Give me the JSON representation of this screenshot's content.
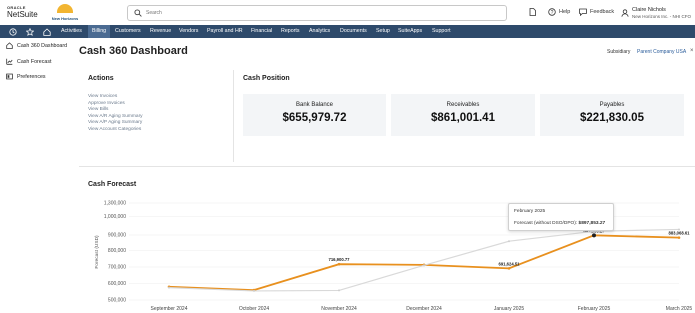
{
  "header": {
    "brand_small": "ORACLE",
    "brand": "NetSuite",
    "company_logo_text": "New Horizons",
    "search_placeholder": "Search",
    "help_label": "Help",
    "feedback_label": "Feedback",
    "user_name": "Claire Nichols",
    "user_role": "New Horizons Inc. - NHI CFO"
  },
  "nav": {
    "items": [
      {
        "label": "Activities"
      },
      {
        "label": "Billing"
      },
      {
        "label": "Customers"
      },
      {
        "label": "Revenue"
      },
      {
        "label": "Vendors"
      },
      {
        "label": "Payroll and HR"
      },
      {
        "label": "Financial"
      },
      {
        "label": "Reports"
      },
      {
        "label": "Analytics"
      },
      {
        "label": "Documents"
      },
      {
        "label": "Setup"
      },
      {
        "label": "SuiteApps"
      },
      {
        "label": "Support"
      }
    ],
    "active": "Billing"
  },
  "sidebar": {
    "items": [
      {
        "label": "Cash 360 Dashboard",
        "icon": "home-icon"
      },
      {
        "label": "Cash Forecast",
        "icon": "chart-icon"
      },
      {
        "label": "Preferences",
        "icon": "settings-icon"
      }
    ]
  },
  "page": {
    "title": "Cash 360 Dashboard",
    "subsidiary_label": "Subsidiary",
    "subsidiary_value": "Parent Company USA",
    "close_symbol": "×"
  },
  "actions": {
    "heading": "Actions",
    "links": [
      "View Invoices",
      "Approve Invoices",
      "View Bills",
      "View A/R Aging Summary",
      "View A/P Aging Summary",
      "View Account Categories"
    ]
  },
  "cash_position": {
    "heading": "Cash Position",
    "cards": [
      {
        "label": "Bank Balance",
        "value": "$655,979.72"
      },
      {
        "label": "Receivables",
        "value": "$861,001.41"
      },
      {
        "label": "Payables",
        "value": "$221,830.05"
      }
    ]
  },
  "forecast": {
    "heading": "Cash Forecast",
    "tooltip": {
      "month": "February 2025",
      "series_label": "Forecast (without DSO/DPO):",
      "value": "$897,853.27"
    }
  },
  "colors": {
    "nav_bg": "#2e4a6b",
    "nav_active": "#4b6b92",
    "forecast_line": "#e8901e",
    "secondary_line": "#d9d9d9"
  },
  "chart_data": {
    "type": "line",
    "ylabel": "Forecast (USD)",
    "ylim": [
      500000,
      1300000
    ],
    "y_ticks": [
      "1,300,000",
      "1,000,000",
      "900,000",
      "800,000",
      "700,000",
      "600,000",
      "500,000"
    ],
    "categories": [
      "September 2024",
      "October 2024",
      "November 2024",
      "December 2024",
      "January 2025",
      "February 2025",
      "March 2025"
    ],
    "series": [
      {
        "name": "Forecast (without DSO/DPO)",
        "values": [
          580000,
          560000,
          716900,
          713000,
          691624,
          897853,
          883068
        ],
        "labels": [
          "",
          "",
          "716,900.77",
          "",
          "691,624.51",
          "897,853.27",
          "883,068.61"
        ],
        "color": "#e8901e"
      },
      {
        "values": [
          575000,
          555000,
          558000,
          710000,
          860000,
          920000,
          930000
        ],
        "labels": [
          "",
          "",
          "",
          "",
          "",
          "",
          ""
        ],
        "color": "#d9d9d9"
      }
    ],
    "grid": true
  }
}
